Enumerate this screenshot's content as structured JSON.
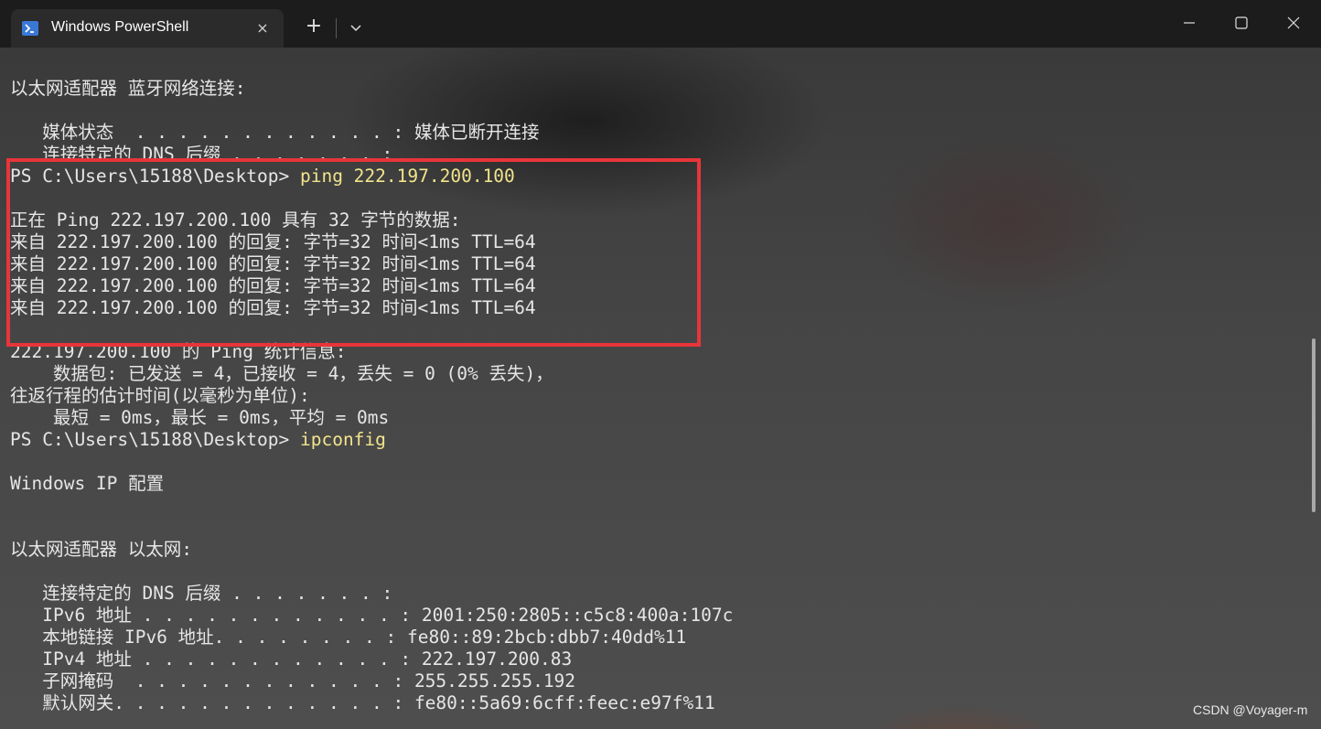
{
  "window": {
    "tab_title": "Windows PowerShell",
    "new_tab_label": "+",
    "close_tab_label": "×",
    "icons": [
      "powershell-icon",
      "close-icon",
      "plus-icon",
      "chevron-down-icon",
      "minimize-icon",
      "maximize-icon",
      "window-close-icon"
    ]
  },
  "terminal": {
    "lines": [
      {
        "prompt": "以太网适配器 蓝牙网络连接:",
        "command": ""
      },
      {
        "prompt": "",
        "command": ""
      },
      {
        "prompt": "   媒体状态  . . . . . . . . . . . . : 媒体已断开连接",
        "command": ""
      },
      {
        "prompt": "   连接特定的 DNS 后缀 . . . . . . . :",
        "command": ""
      },
      {
        "prompt": "PS C:\\Users\\15188\\Desktop> ",
        "command": "ping 222.197.200.100"
      },
      {
        "prompt": "",
        "command": ""
      },
      {
        "prompt": "正在 Ping 222.197.200.100 具有 32 字节的数据:",
        "command": ""
      },
      {
        "prompt": "来自 222.197.200.100 的回复: 字节=32 时间<1ms TTL=64",
        "command": ""
      },
      {
        "prompt": "来自 222.197.200.100 的回复: 字节=32 时间<1ms TTL=64",
        "command": ""
      },
      {
        "prompt": "来自 222.197.200.100 的回复: 字节=32 时间<1ms TTL=64",
        "command": ""
      },
      {
        "prompt": "来自 222.197.200.100 的回复: 字节=32 时间<1ms TTL=64",
        "command": ""
      },
      {
        "prompt": "",
        "command": ""
      },
      {
        "prompt": "222.197.200.100 的 Ping 统计信息:",
        "command": ""
      },
      {
        "prompt": "    数据包: 已发送 = 4，已接收 = 4，丢失 = 0 (0% 丢失)，",
        "command": ""
      },
      {
        "prompt": "往返行程的估计时间(以毫秒为单位):",
        "command": ""
      },
      {
        "prompt": "    最短 = 0ms，最长 = 0ms，平均 = 0ms",
        "command": ""
      },
      {
        "prompt": "PS C:\\Users\\15188\\Desktop> ",
        "command": "ipconfig"
      },
      {
        "prompt": "",
        "command": ""
      },
      {
        "prompt": "Windows IP 配置",
        "command": ""
      },
      {
        "prompt": "",
        "command": ""
      },
      {
        "prompt": "",
        "command": ""
      },
      {
        "prompt": "以太网适配器 以太网:",
        "command": ""
      },
      {
        "prompt": "",
        "command": ""
      },
      {
        "prompt": "   连接特定的 DNS 后缀 . . . . . . . :",
        "command": ""
      },
      {
        "prompt": "   IPv6 地址 . . . . . . . . . . . . : 2001:250:2805::c5c8:400a:107c",
        "command": ""
      },
      {
        "prompt": "   本地链接 IPv6 地址. . . . . . . . : fe80::89:2bcb:dbb7:40dd%11",
        "command": ""
      },
      {
        "prompt": "   IPv4 地址 . . . . . . . . . . . . : 222.197.200.83",
        "command": ""
      },
      {
        "prompt": "   子网掩码  . . . . . . . . . . . . : 255.255.255.192",
        "command": ""
      },
      {
        "prompt": "   默认网关. . . . . . . . . . . . . : fe80::5a69:6cff:feec:e97f%11",
        "command": ""
      }
    ]
  },
  "colors": {
    "highlight_box": "#e8353a",
    "command_text": "#f2e48c",
    "output_text": "#e6e6e6"
  },
  "watermark": "CSDN @Voyager-m"
}
